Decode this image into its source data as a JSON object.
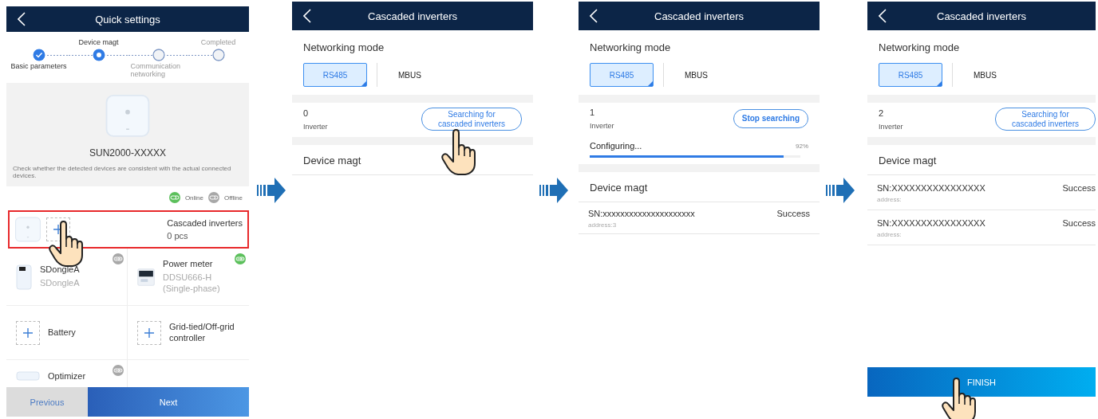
{
  "screens": [
    {
      "kind": "quick",
      "title": "Quick settings",
      "steps": [
        {
          "label": "Basic parameters",
          "done": true,
          "current": false
        },
        {
          "label": "Device magt",
          "done": false,
          "current": true
        },
        {
          "label": "Communication networking",
          "done": false,
          "current": false
        },
        {
          "label": "Completed",
          "done": false,
          "current": false
        }
      ],
      "device": {
        "name": "SUN2000-XXXXX"
      },
      "note": "Check whether the detected devices are consistent with the actual connected devices.",
      "legend": [
        {
          "label": "Online",
          "color": "#5cc05c"
        },
        {
          "label": "Offline",
          "color": "#a8a8a8"
        }
      ],
      "highlight": {
        "title": "Cascaded inverters",
        "count": "0 pcs",
        "pointer": true
      },
      "devices": [
        {
          "kind": "dongle",
          "name": "SDongleA",
          "model": "SDongleA",
          "online": false
        },
        {
          "kind": "meter",
          "name": "Power meter",
          "model": "DDSU666-H (Single-phase)",
          "online": true
        },
        {
          "kind": "empty",
          "name": "Battery"
        },
        {
          "kind": "empty",
          "name": "Grid-tied/Off-grid controller"
        },
        {
          "kind": "box",
          "name": "Optimizer",
          "online": false
        }
      ],
      "buttons": [
        {
          "label": "Previous",
          "kind": "secondary"
        },
        {
          "label": "Next",
          "kind": "primary"
        }
      ]
    },
    {
      "kind": "cascade",
      "title": "Cascaded inverters",
      "modes": [
        {
          "label": "RS485",
          "selected": true
        },
        {
          "label": "MBUS",
          "selected": false
        }
      ],
      "mode_title": "Networking mode",
      "count": "0",
      "count_label": "Inverter",
      "search_button": {
        "label": "Searching for cascaded inverters",
        "kind": "search",
        "pointer": true
      },
      "section": "Device magt"
    },
    {
      "kind": "cascade",
      "title": "Cascaded inverters",
      "modes": [
        {
          "label": "RS485",
          "selected": true
        },
        {
          "label": "MBUS",
          "selected": false
        }
      ],
      "mode_title": "Networking mode",
      "count": "1",
      "count_label": "Inverter",
      "search_button": {
        "label": "Stop searching",
        "kind": "stop",
        "pointer": false
      },
      "progress": {
        "label": "Configuring...",
        "reading": "92%",
        "level": 0.92
      },
      "section": "Device magt",
      "results": [
        {
          "sn": "SN:xxxxxxxxxxxxxxxxxxxxx",
          "status": "Success",
          "address": "address:3"
        }
      ]
    },
    {
      "kind": "cascade",
      "title": "Cascaded inverters",
      "modes": [
        {
          "label": "RS485",
          "selected": true
        },
        {
          "label": "MBUS",
          "selected": false
        }
      ],
      "mode_title": "Networking mode",
      "count": "2",
      "count_label": "Inverter",
      "search_button": {
        "label": "Searching for cascaded inverters",
        "kind": "search",
        "pointer": false
      },
      "section": "Device magt",
      "results": [
        {
          "sn": "SN:XXXXXXXXXXXXXXXX",
          "status": "Success",
          "address": "address:"
        },
        {
          "sn": "SN:XXXXXXXXXXXXXXXX",
          "status": "Success",
          "address": "address:"
        }
      ],
      "finish_button": {
        "label": "FINISH",
        "pointer": true
      }
    }
  ]
}
